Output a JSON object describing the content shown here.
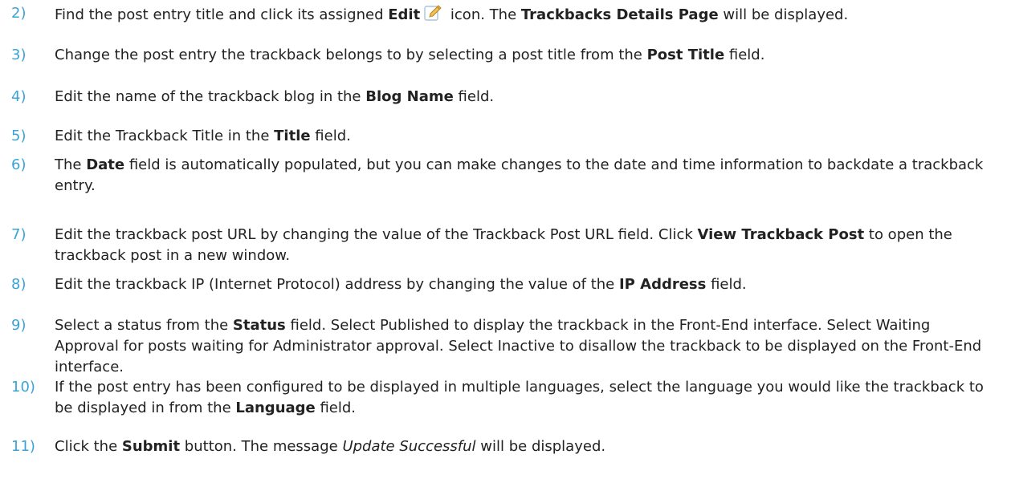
{
  "steps": [
    {
      "num": "2)",
      "segments": [
        {
          "t": "Find the post entry title and click its assigned "
        },
        {
          "t": "Edit",
          "b": true
        },
        {
          "icon": "pencil-edit-icon"
        },
        {
          "t": " icon. The "
        },
        {
          "t": "Trackbacks Details Page",
          "b": true
        },
        {
          "t": " will be displayed."
        }
      ]
    },
    {
      "num": "3)",
      "segments": [
        {
          "t": "Change the post entry the trackback belongs to by selecting a post title from the "
        },
        {
          "t": "Post Title",
          "b": true
        },
        {
          "t": " field."
        }
      ]
    },
    {
      "num": "4)",
      "segments": [
        {
          "t": "Edit the name of the trackback blog in the "
        },
        {
          "t": "Blog Name",
          "b": true
        },
        {
          "t": " field."
        }
      ]
    },
    {
      "num": "5)",
      "segments": [
        {
          "t": "Edit the Trackback Title in the "
        },
        {
          "t": "Title",
          "b": true
        },
        {
          "t": " field."
        }
      ]
    },
    {
      "num": "6)",
      "segments": [
        {
          "t": "The "
        },
        {
          "t": "Date",
          "b": true
        },
        {
          "t": " field is automatically populated, but you can make changes to the date and time information to backdate a trackback entry."
        }
      ]
    },
    {
      "num": "7)",
      "segments": [
        {
          "t": "Edit the trackback post URL by changing the value of the Trackback Post URL field. Click "
        },
        {
          "t": "View Trackback Post",
          "b": true
        },
        {
          "t": " to open the trackback post in a new window."
        }
      ]
    },
    {
      "num": "8)",
      "segments": [
        {
          "t": "Edit the trackback IP (Internet Protocol) address by changing the value of the "
        },
        {
          "t": "IP Address",
          "b": true
        },
        {
          "t": " field."
        }
      ]
    },
    {
      "num": "9)",
      "segments": [
        {
          "t": "Select a status from the "
        },
        {
          "t": "Status",
          "b": true
        },
        {
          "t": " field. Select Published to display the trackback in the Front-End interface. Select Waiting Approval for posts waiting for Administrator approval. Select Inactive to disallow the trackback to be displayed on the Front-End interface."
        }
      ]
    },
    {
      "num": "10)",
      "segments": [
        {
          "t": "If the post entry has been configured to be displayed in multiple languages, select the language you would like the trackback to be displayed in from the "
        },
        {
          "t": "Language",
          "b": true
        },
        {
          "t": " field."
        }
      ]
    },
    {
      "num": "11)",
      "segments": [
        {
          "t": "Click the "
        },
        {
          "t": "Submit",
          "b": true
        },
        {
          "t": " button. The message "
        },
        {
          "t": "Update Successful",
          "i": true
        },
        {
          "t": " will be displayed."
        }
      ]
    }
  ],
  "colors": {
    "number": "#3aa3d6",
    "text": "#222222",
    "pencil_body": "#f2c14e",
    "pencil_tip": "#e8a24a",
    "pencil_edge": "#b07a1a",
    "icon_frame": "#a9c4dc"
  }
}
